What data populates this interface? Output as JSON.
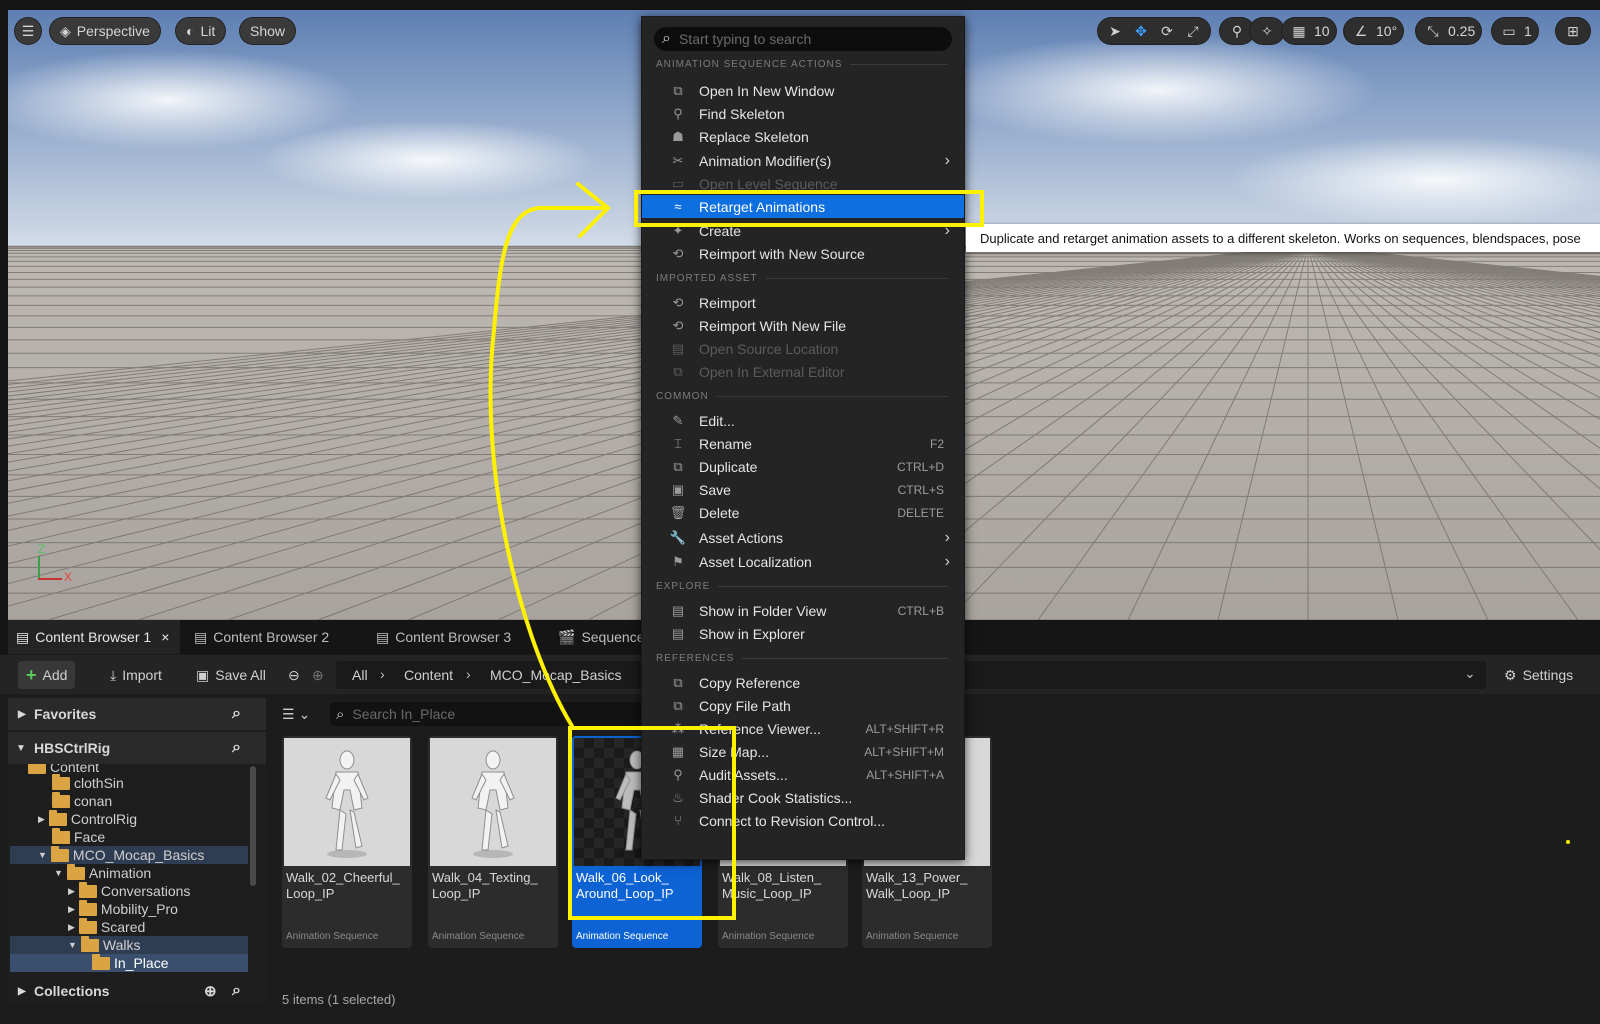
{
  "viewport": {
    "perspective_label": "Perspective",
    "lit_label": "Lit",
    "show_label": "Show",
    "grid_value": "10",
    "angle_value": "10°",
    "scale_value": "0.25",
    "camera_value": "1",
    "axis_z": "Z",
    "axis_x": "X"
  },
  "menu": {
    "search_placeholder": "Start typing to search",
    "sections": {
      "anim": "ANIMATION SEQUENCE ACTIONS",
      "imported": "IMPORTED ASSET",
      "common": "COMMON",
      "explore": "EXPLORE",
      "references": "REFERENCES"
    },
    "items": {
      "open_new_window": "Open In New Window",
      "find_skeleton": "Find Skeleton",
      "replace_skeleton": "Replace Skeleton",
      "anim_modifiers": "Animation Modifier(s)",
      "open_level_sequence": "Open Level Sequence",
      "retarget": "Retarget Animations",
      "create": "Create",
      "reimport_new_source": "Reimport with New Source",
      "reimport": "Reimport",
      "reimport_new_file": "Reimport With New File",
      "open_source_location": "Open Source Location",
      "open_external_editor": "Open In External Editor",
      "edit": "Edit...",
      "rename": "Rename",
      "duplicate": "Duplicate",
      "save": "Save",
      "delete": "Delete",
      "asset_actions": "Asset Actions",
      "asset_localization": "Asset Localization",
      "show_folder_view": "Show in Folder View",
      "show_explorer": "Show in Explorer",
      "copy_reference": "Copy Reference",
      "copy_file_path": "Copy File Path",
      "reference_viewer": "Reference Viewer...",
      "size_map": "Size Map...",
      "audit_assets": "Audit Assets...",
      "shader_cook": "Shader Cook Statistics...",
      "connect_revision": "Connect to Revision Control..."
    },
    "shortcuts": {
      "rename": "F2",
      "duplicate": "CTRL+D",
      "save": "CTRL+S",
      "delete": "DELETE",
      "show_folder_view": "CTRL+B",
      "reference_viewer": "ALT+SHIFT+R",
      "size_map": "ALT+SHIFT+M",
      "audit_assets": "ALT+SHIFT+A"
    }
  },
  "tooltip": "Duplicate and retarget animation assets to a different skeleton. Works on sequences, blendspaces, pose",
  "tabs": [
    "Content Browser 1",
    "Content Browser 2",
    "Content Browser 3",
    "Sequence"
  ],
  "toolbar": {
    "add": "Add",
    "import": "Import",
    "save_all": "Save All",
    "crumbs": [
      "All",
      "Content",
      "MCO_Mocap_Basics"
    ],
    "settings": "Settings"
  },
  "sidebar": {
    "favorites": "Favorites",
    "project": "HBSCtrlRig",
    "collections": "Collections",
    "tree": [
      "Content",
      "clothSin",
      "conan",
      "ControlRig",
      "Face",
      "MCO_Mocap_Basics",
      "Animation",
      "Conversations",
      "Mobility_Pro",
      "Scared",
      "Walks",
      "In_Place"
    ]
  },
  "assets": {
    "search_placeholder": "Search In_Place",
    "status": "5 items (1 selected)",
    "items": [
      {
        "name": "Walk_02_Cheerful_ Loop_IP",
        "type": "Animation Sequence"
      },
      {
        "name": "Walk_04_Texting_ Loop_IP",
        "type": "Animation Sequence"
      },
      {
        "name": "Walk_06_Look_ Around_Loop_IP",
        "type": "Animation Sequence"
      },
      {
        "name": "Walk_08_Listen_ Music_Loop_IP",
        "type": "Animation Sequence"
      },
      {
        "name": "Walk_13_Power_ Walk_Loop_IP",
        "type": "Animation Sequence"
      }
    ]
  },
  "colors": {
    "highlight": "#0D6FE0",
    "annotation": "#FFF200",
    "folder": "#D9A441"
  }
}
